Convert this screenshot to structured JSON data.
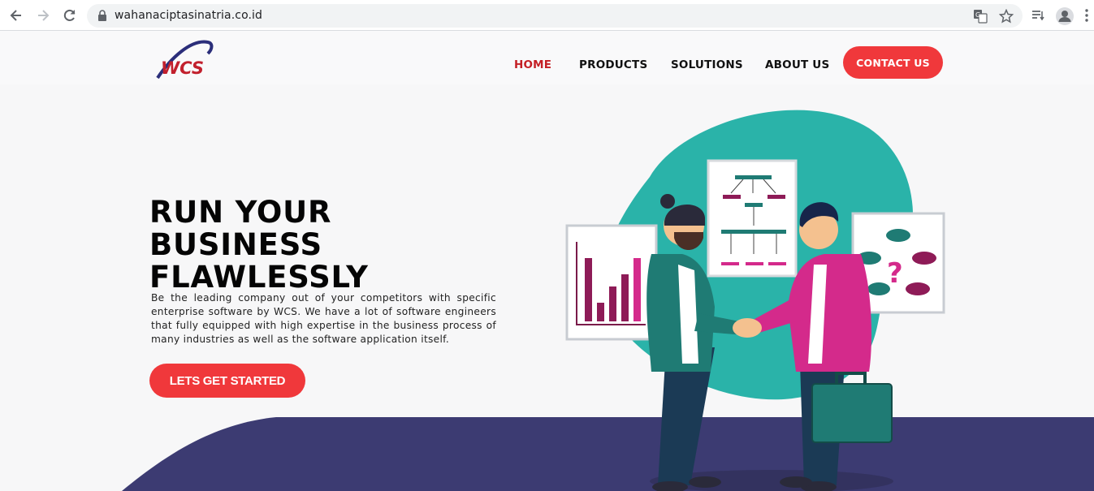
{
  "browser": {
    "url": "wahanaciptasinatria.co.id"
  },
  "header": {
    "logo_text": "WCS",
    "nav": [
      {
        "label": "HOME",
        "active": true
      },
      {
        "label": "PRODUCTS",
        "active": false
      },
      {
        "label": "SOLUTIONS",
        "active": false
      },
      {
        "label": "ABOUT US",
        "active": false
      }
    ],
    "contact_label": "CONTACT US"
  },
  "hero": {
    "title_line1": "RUN YOUR BUSINESS",
    "title_line2": "FLAWLESSLY",
    "description": "Be the leading company out of your competitors with specific enterprise software by WCS. We have a lot of software engineers that fully equipped with high expertise in the business process of many industries as well as the software application itself.",
    "cta_label": "LETS GET STARTED"
  },
  "colors": {
    "accent": "#f0383b",
    "nav_active": "#c41f25",
    "footer_band": "#3c3b72",
    "teal": "#2ab3a9",
    "magenta": "#d42a8b"
  }
}
